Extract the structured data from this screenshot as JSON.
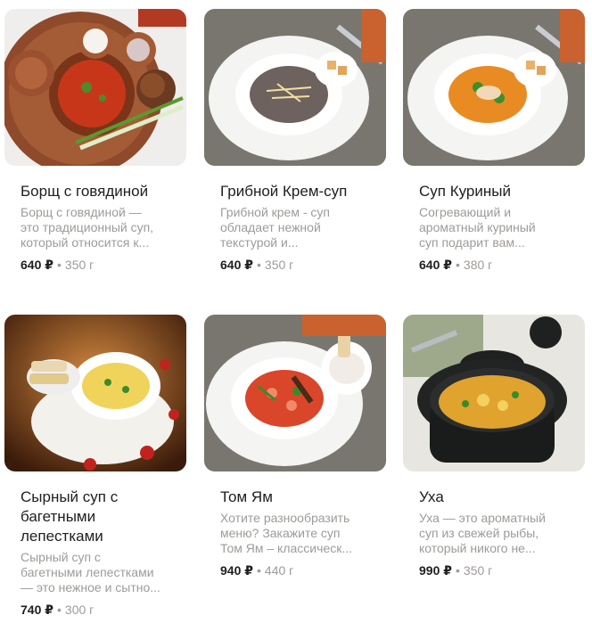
{
  "products": [
    {
      "title": "Борщ с говядиной",
      "description": [
        "Борщ с говядиной —",
        "это традиционный суп,",
        "который относится к..."
      ],
      "price": "640 ₽",
      "weight": "350 г",
      "image_icon": "borscht-photo"
    },
    {
      "title": "Грибной Крем-суп",
      "description": [
        "Грибной крем - суп",
        "обладает нежной",
        "текстурой и..."
      ],
      "price": "640 ₽",
      "weight": "350 г",
      "image_icon": "mushroom-soup-photo"
    },
    {
      "title": "Суп Куриный",
      "description": [
        "Согревающий и",
        "ароматный куриный",
        "суп подарит вам..."
      ],
      "price": "640 ₽",
      "weight": "380 г",
      "image_icon": "chicken-soup-photo"
    },
    {
      "title_lines": [
        "Сырный суп с",
        "багетными",
        "лепестками"
      ],
      "description": [
        "Сырный суп с",
        "багетными лепестками",
        "— это нежное и сытно..."
      ],
      "price": "740 ₽",
      "weight": "300 г",
      "image_icon": "cheese-soup-photo"
    },
    {
      "title": "Том Ям",
      "description": [
        "Хотите разнообразить",
        "меню? Закажите суп",
        "Том Ям – классическ..."
      ],
      "price": "940 ₽",
      "weight": "440 г",
      "image_icon": "tom-yum-photo"
    },
    {
      "title": "Уха",
      "description": [
        "Уха — это ароматный",
        "суп из свежей рыбы,",
        "который никого не..."
      ],
      "price": "990 ₽",
      "weight": "350 г",
      "image_icon": "fish-soup-photo"
    }
  ],
  "separator": "•",
  "colors": {
    "title": "#21201f",
    "muted": "#9e9b98",
    "background": "#ffffff"
  }
}
